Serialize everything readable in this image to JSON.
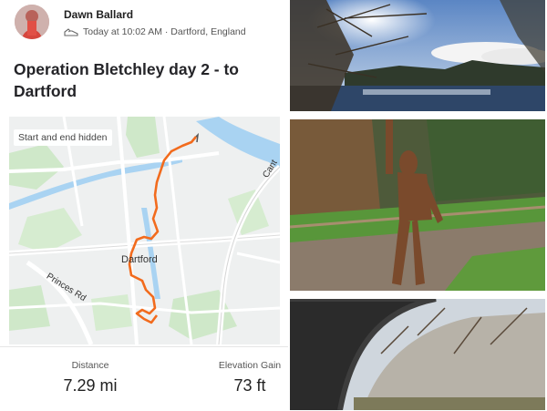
{
  "author": {
    "name": "Dawn Ballard"
  },
  "activity": {
    "time_location": "Today at 10:02 AM · Dartford, England",
    "title": "Operation Bletchley day 2 - to Dartford"
  },
  "map": {
    "privacy_badge": "Start and end hidden",
    "town_label": "Dartford",
    "road_label": "Princes Rd",
    "road_label_2": "Cant",
    "route_color": "#f26b1d"
  },
  "stats": {
    "distance_label": "Distance",
    "distance_value": "7.29 mi",
    "elevation_label": "Elevation Gain",
    "elevation_value": "73 ft"
  },
  "photos": [
    {
      "subject": "Sunlit lake through bare winter trees"
    },
    {
      "subject": "Rusted metal figure sculpture beside a footpath"
    },
    {
      "subject": "Brick bridge arch framing bare trees"
    }
  ]
}
